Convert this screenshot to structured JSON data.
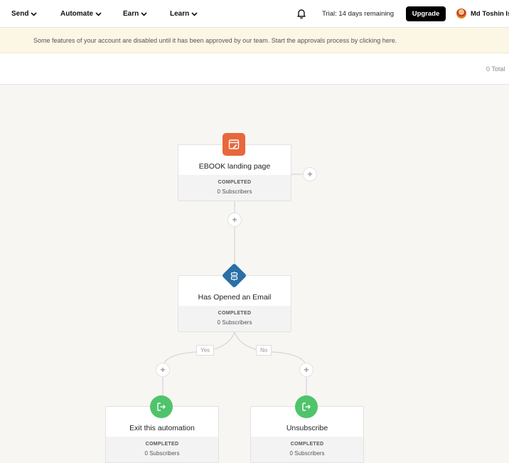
{
  "nav": {
    "items": [
      {
        "label": "Send"
      },
      {
        "label": "Automate"
      },
      {
        "label": "Earn"
      },
      {
        "label": "Learn"
      }
    ],
    "trial_text": "Trial: 14 days remaining",
    "upgrade_label": "Upgrade",
    "user_name": "Md Toshin Is"
  },
  "banner": {
    "text": "Some features of your account are disabled until it has been approved by our team. Start the approvals process by clicking here."
  },
  "stats": {
    "total": "0 Total"
  },
  "flow": {
    "nodes": [
      {
        "title": "EBOOK landing page",
        "status": "COMPLETED",
        "subscribers": "0 Subscribers"
      },
      {
        "title": "Has Opened an Email",
        "status": "COMPLETED",
        "subscribers": "0 Subscribers"
      },
      {
        "title": "Exit this automation",
        "status": "COMPLETED",
        "subscribers": "0 Subscribers"
      },
      {
        "title": "Unsubscribe",
        "status": "COMPLETED",
        "subscribers": "0 Subscribers"
      }
    ],
    "branches": {
      "yes": "Yes",
      "no": "No"
    },
    "add_symbol": "+"
  },
  "colors": {
    "trigger_badge": "#e8673c",
    "condition_badge": "#2a6fa6",
    "action_badge": "#4fc46b",
    "banner_bg": "#fcf6e4",
    "canvas_bg": "#f7f6f3"
  },
  "icons": {
    "trigger": "landing-page-icon",
    "condition": "split-icon",
    "exit": "exit-icon",
    "unsubscribe": "exit-icon",
    "notifications": "bell-icon",
    "dropdown": "chevron-down-icon"
  }
}
